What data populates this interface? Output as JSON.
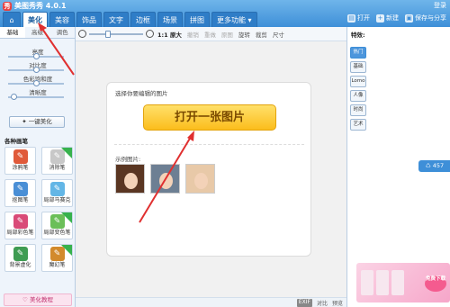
{
  "app": {
    "title": "美图秀秀 4.0.1",
    "logo_glyph": "秀"
  },
  "tabs": [
    {
      "label": "美化",
      "active": true
    },
    {
      "label": "美容"
    },
    {
      "label": "饰品"
    },
    {
      "label": "文字"
    },
    {
      "label": "边框"
    },
    {
      "label": "场景"
    },
    {
      "label": "拼图"
    },
    {
      "label": "更多功能 ▾"
    }
  ],
  "top_actions": {
    "login": "登录",
    "open": "打开",
    "new": "新建",
    "save_share": "保存与分享"
  },
  "left_panel": {
    "subtabs": [
      "基础",
      "高级",
      "调色"
    ],
    "sliders": [
      {
        "label": "亮度",
        "value": 0.5
      },
      {
        "label": "对比度",
        "value": 0.5
      },
      {
        "label": "色彩饱和度",
        "value": 0.5
      },
      {
        "label": "清晰度",
        "value": 0.1
      }
    ],
    "one_key": "一键美化",
    "pens_title": "各种画笔",
    "pens": [
      {
        "label": "涂鸦笔",
        "icon": "doodle-pen",
        "color": "#e05a3a"
      },
      {
        "label": "消除笔",
        "icon": "eraser-pen",
        "color": "#c8c8c8",
        "new": true
      },
      {
        "label": "抠图笔",
        "icon": "cutout-pen",
        "color": "#4a8fd6"
      },
      {
        "label": "局部马赛克",
        "icon": "mosaic-pen",
        "color": "#63b6e6"
      },
      {
        "label": "局部彩色笔",
        "icon": "color-pen",
        "color": "#d94b78"
      },
      {
        "label": "局部变色笔",
        "icon": "recolor-pen",
        "color": "#6bbf59",
        "new": true
      },
      {
        "label": "背景虚化",
        "icon": "blur-background",
        "color": "#3f9c52"
      },
      {
        "label": "魔幻笔",
        "icon": "magic-pen",
        "color": "#d28a2c",
        "new": true
      }
    ],
    "pen_icon_glyph": "✎",
    "tutorial": "美化教程"
  },
  "toolbar": {
    "zoom_label": "1:1 原大",
    "rotate": "旋转",
    "crop": "裁剪",
    "size": "尺寸",
    "undo": "撤销",
    "redo": "重做",
    "restore": "原图"
  },
  "canvas": {
    "select_label": "选择你要编辑的图片",
    "open_button": "打开一张图片",
    "example_label": "示例图片:"
  },
  "status": {
    "exif": "EXIF",
    "compare": "对比",
    "preview": "预览"
  },
  "right_panel": {
    "title": "特效:",
    "categories": [
      "热门",
      "基础",
      "Lomo",
      "人像",
      "时尚",
      "艺术"
    ],
    "share_count": "457",
    "promo_free": "免费下载"
  }
}
